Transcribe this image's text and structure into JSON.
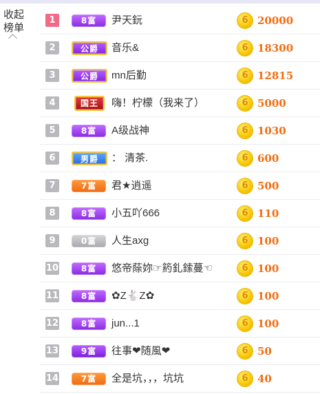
{
  "collapse": {
    "line1": "收起",
    "line2": "榜单"
  },
  "coin_glyph": "6",
  "rows": [
    {
      "rank": "1",
      "badge": "8富",
      "badge_type": "fu8",
      "name": "尹天鈨",
      "amount": "20000"
    },
    {
      "rank": "2",
      "badge": "公爵",
      "badge_type": "gongjue",
      "name": "音乐&",
      "amount": "18300"
    },
    {
      "rank": "3",
      "badge": "公爵",
      "badge_type": "gongjue",
      "name": "mn后勤",
      "amount": "12815"
    },
    {
      "rank": "4",
      "badge": "国王",
      "badge_type": "guowang",
      "name": "嗨！柠檬（我来了）",
      "amount": "5000"
    },
    {
      "rank": "5",
      "badge": "8富",
      "badge_type": "fu8",
      "name": "A级战神",
      "amount": "1030"
    },
    {
      "rank": "6",
      "badge": "男爵",
      "badge_type": "nanjue",
      "name": "：  清茶.",
      "amount": "600"
    },
    {
      "rank": "7",
      "badge": "7富",
      "badge_type": "fu7",
      "name": "君★逍遥",
      "amount": "500"
    },
    {
      "rank": "8",
      "badge": "8富",
      "badge_type": "fu8",
      "name": "小五吖666",
      "amount": "110"
    },
    {
      "rank": "9",
      "badge": "0富",
      "badge_type": "fu0",
      "name": "人生axg",
      "amount": "100"
    },
    {
      "rank": "10",
      "badge": "8富",
      "badge_type": "fu8",
      "name": "悠帝蒢妳☞箹釓鎍蔓☜",
      "amount": "100"
    },
    {
      "rank": "11",
      "badge": "8富",
      "badge_type": "fu8",
      "name": "✿Z🐇Z✿",
      "amount": "100"
    },
    {
      "rank": "12",
      "badge": "8富",
      "badge_type": "fu8",
      "name": "jun...1",
      "amount": "100"
    },
    {
      "rank": "13",
      "badge": "9富",
      "badge_type": "fu9",
      "name": "往事❤随風❤",
      "amount": "50"
    },
    {
      "rank": "14",
      "badge": "7富",
      "badge_type": "fu7",
      "name": "全是坑，，，坑坑",
      "amount": "40"
    }
  ]
}
